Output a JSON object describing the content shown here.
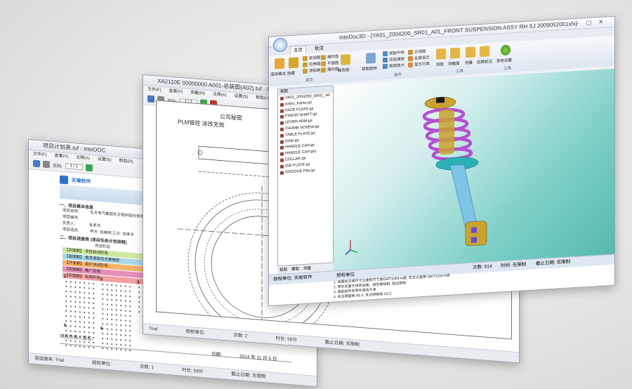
{
  "window1": {
    "title": "项目计划表.tuf - InteDOC",
    "menu": [
      "文件(F)",
      "查看(V)",
      "注释(A)",
      "设置(S)",
      "帮助(H)"
    ],
    "page_label": "页码:",
    "page_value": "1 / 1",
    "logo_text": "天喻软件",
    "heading": "项目",
    "section1": "一、项目基本信息",
    "fields": [
      {
        "label": "项目名称:",
        "value": "东方电气集团东方锅炉股份有限公司"
      },
      {
        "label": "项目编号:",
        "value": ""
      },
      {
        "label": "负责人:",
        "value": "张孝洋"
      },
      {
        "label": "项目成员:",
        "value": "甲方: 张晓明  乙方: 张孝洋"
      }
    ],
    "section2": "二、项目进度表   (项目任务计划排程)",
    "stage_header": "项目阶段",
    "stages": [
      {
        "label": "【实施期】 项目启动阶段",
        "color": "#cfe8a0",
        "date": "2014"
      },
      {
        "label": "【蓝图期】 需求调研及方案确定",
        "color": "#a7d8e8",
        "date": "2014"
      },
      {
        "label": "【开发期】 用户测试阶段",
        "color": "#f6b26b",
        "date": "2014"
      },
      {
        "label": "【实施期】 推广应用",
        "color": "#e58fb8",
        "date": "2014"
      },
      {
        "label": "【实施期】 验收阶段",
        "color": "#f4a0a0",
        "date": "2014"
      }
    ],
    "months": [
      "1",
      "2",
      "3",
      "4",
      "5",
      "6",
      "7",
      "8"
    ],
    "signature_label": "项目负责人签名:",
    "date_label": "日期:",
    "date_value": "2014 年 11 月 5 日",
    "status": {
      "mode": "波送版本: Trial",
      "unit": "授权单位:",
      "count": "次数: 1",
      "duration": "时长: 59分",
      "deadline": "截止日期: 无限制"
    }
  },
  "window2": {
    "title": "XA2110E 00000000 A001-总装图(A02).tuf - InteDOC",
    "menu": [
      "文件(F)",
      "查看(V)",
      "测量(M)",
      "注释(A)",
      "设置(S)",
      "帮助(H)"
    ],
    "page_label": "页码:",
    "page_value": "1 / 1",
    "watermark1": "公司秘密",
    "watermark2": "PLM管控  涂改无效",
    "status": {
      "mode": "Trial",
      "unit": "授权单位:",
      "count": "次数: 2",
      "duration": "时长: 59分",
      "deadline": "截止日期: 无限制"
    }
  },
  "window3": {
    "title": "InteDoc3D - [YA01_2004200_SR01_A01_FRONT SUSPENSION ASSY RH SJ 2009052001xfx]",
    "tabs": [
      "主页",
      "批注"
    ],
    "groups": {
      "g1": {
        "label": "显示",
        "buttons": [
          "渲染模式",
          "隐藏",
          "剖视图",
          "拉伸图",
          "添加剖面",
          "爆炸图",
          "平面图",
          "爆炸图",
          "剖视图",
          "着色图"
        ]
      },
      "g2": {
        "label": "操作",
        "buttons": [
          "视图旋转",
          "视图平移",
          "动态缩放",
          "局部放大",
          "正视图",
          "全屏显示",
          "显示行类"
        ]
      },
      "g3": {
        "label": "工具",
        "buttons": [
          "测距",
          "测截面",
          "测量",
          "创建标注"
        ]
      },
      "g4": {
        "label": "工具",
        "buttons": [
          "系统设置"
        ]
      }
    },
    "tree_header": "视图",
    "tree_items": [
      "YA01_2004200_SR01_A0",
      "Arbor_frame.ipt",
      "FACE PLATE.ipt",
      "PINION SHAFT.ipt",
      "LEVER ARM.ipt",
      "THUMB SCREW.ipt",
      "TABLE PLATE.ipt",
      "RAM.ipt",
      "HANDLE CAP.ipt",
      "HANDLE CAP.ipt1",
      "COLLAR.ipt",
      "GIB PLATE.ipt",
      "GROOVE PIN.ipt"
    ],
    "bottom_tabs": [
      "视图",
      "模型",
      "测量"
    ],
    "status": {
      "unit": "授权单位: 天喻软件",
      "user": "授权单位",
      "count": "次数: 514",
      "duration": "时间: 无限制",
      "deadline": "截止日期: 无限制"
    },
    "notes": [
      "1. 本图未注明尺寸公差的尺寸按GB/T1804-m级, 形位公差按 GB/T1184-K级",
      "2. 零件表面不得有划痕、碰伤等缺陷, 锐边倒钝",
      "3. 装配前所有零件清洗干净",
      "4. 未注明圆角 R0.5, 未注明倒角 C0.5"
    ],
    "colors": {
      "spring": "#b64fd0",
      "gold": "#c9a230",
      "shaft": "#7ec3e8",
      "mount": "#2ab0b5",
      "vp_start": "#ffffff",
      "vp_end": "#53b8b0"
    }
  }
}
